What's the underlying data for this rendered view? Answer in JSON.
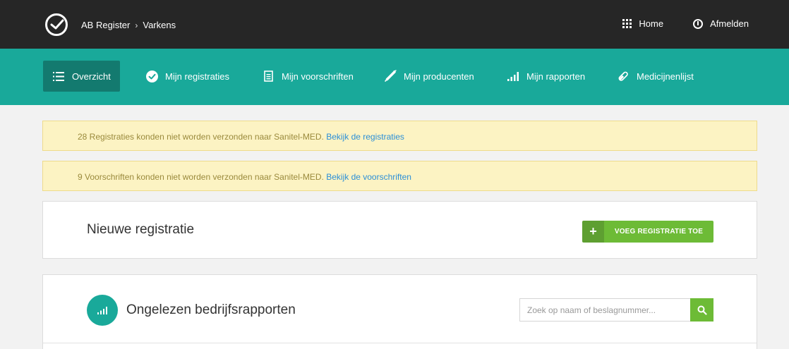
{
  "topbar": {
    "breadcrumb": [
      "AB Register",
      "Varkens"
    ],
    "home_label": "Home",
    "logout_label": "Afmelden"
  },
  "nav": {
    "items": [
      {
        "label": "Overzicht",
        "icon": "list-icon",
        "active": true
      },
      {
        "label": "Mijn registraties",
        "icon": "check-circle-icon",
        "active": false
      },
      {
        "label": "Mijn voorschriften",
        "icon": "document-icon",
        "active": false
      },
      {
        "label": "Mijn producenten",
        "icon": "syringe-icon",
        "active": false
      },
      {
        "label": "Mijn rapporten",
        "icon": "signal-bars-icon",
        "active": false
      },
      {
        "label": "Medicijnenlijst",
        "icon": "pill-icon",
        "active": false
      }
    ]
  },
  "alerts": [
    {
      "text": "28 Registraties konden niet worden verzonden naar Sanitel-MED.",
      "link": "Bekijk de registraties"
    },
    {
      "text": "9 Voorschriften konden niet worden verzonden naar Sanitel-MED.",
      "link": "Bekijk de voorschriften"
    }
  ],
  "new_registration": {
    "title": "Nieuwe registratie",
    "button_label": "VOEG REGISTRATIE TOE"
  },
  "reports": {
    "title": "Ongelezen bedrijfsrapporten",
    "search_placeholder": "Zoek op naam of beslagnummer..."
  },
  "colors": {
    "topbar": "#262626",
    "nav": "#19a99a",
    "nav_active": "#137a6f",
    "alert_bg": "#fcf3c3",
    "link": "#2b8fd8",
    "green_button": "#6dbb36"
  }
}
